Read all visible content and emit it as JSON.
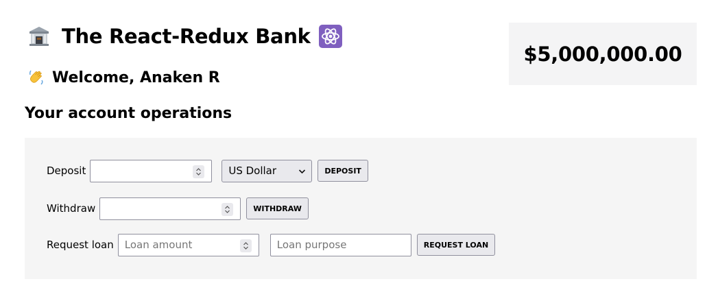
{
  "header": {
    "title": "The React-Redux Bank",
    "bank_icon": "bank-building-icon",
    "atom_icon": "atom-icon",
    "welcome_text": "Welcome, Anaken R",
    "wave_icon": "waving-hand-icon"
  },
  "balance": {
    "amount": "$5,000,000.00"
  },
  "operations": {
    "title": "Your account operations",
    "deposit": {
      "label": "Deposit",
      "value": "",
      "currency_selected": "US Dollar",
      "button_label": "DEPOSIT"
    },
    "withdraw": {
      "label": "Withdraw",
      "value": "",
      "button_label": "WITHDRAW"
    },
    "loan": {
      "label": "Request loan",
      "amount_placeholder": "Loan amount",
      "purpose_placeholder": "Loan purpose",
      "button_label": "REQUEST LOAN"
    }
  },
  "colors": {
    "panel_background": "#f5f5f5",
    "balance_background": "#f4f4f5",
    "button_background": "#e9e9ed",
    "atom_icon_background": "#7f5fbf"
  }
}
